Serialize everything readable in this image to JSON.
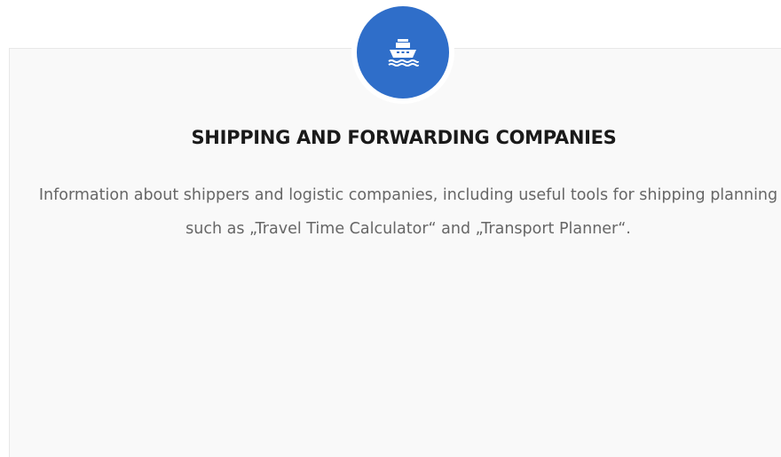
{
  "feature": {
    "icon": "ship-icon",
    "title": "SHIPPING AND FORWARDING COMPANIES",
    "description": "Information about shippers and logistic companies, including useful tools for shipping planning such as „Travel Time Calculator“ and „Transport Planner“."
  },
  "colors": {
    "accent": "#2f6ec9",
    "card_background": "#f9f9f9",
    "title_text": "#1a1a1a",
    "body_text": "#666666"
  }
}
